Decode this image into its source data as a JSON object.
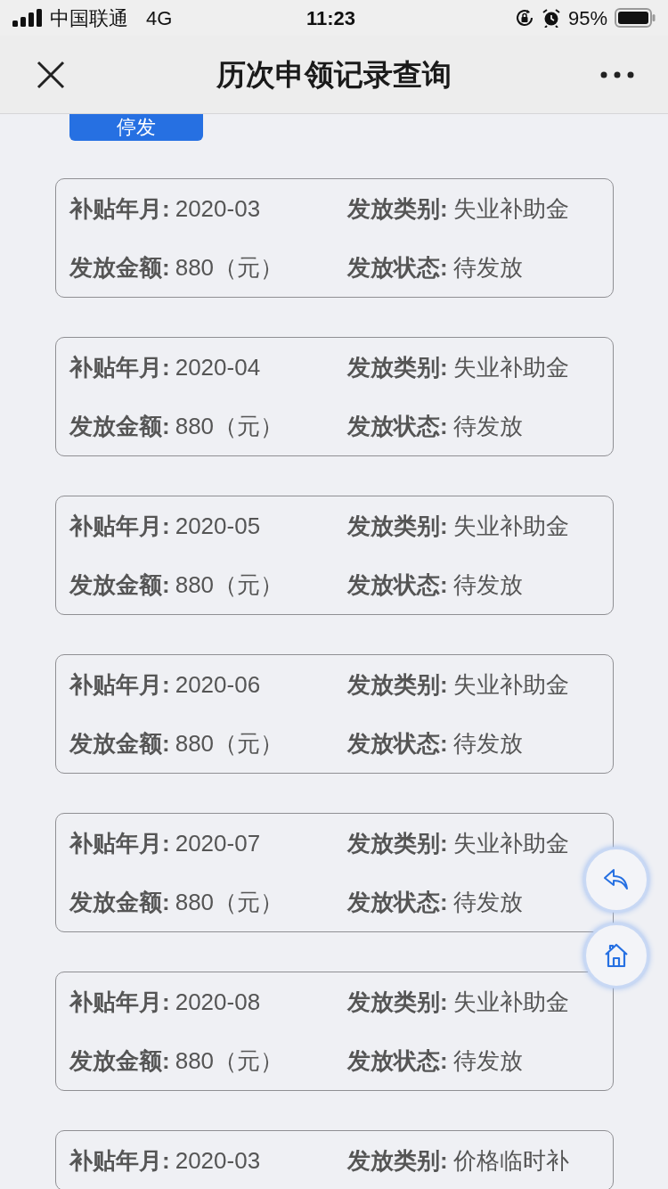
{
  "status_bar": {
    "carrier": "中国联通",
    "network": "4G",
    "time": "11:23",
    "battery": "95%"
  },
  "nav": {
    "title": "历次申领记录查询"
  },
  "top_button": {
    "label": "停发"
  },
  "records": [
    {
      "fields": [
        {
          "label": "补贴年月:",
          "value": "2020-03"
        },
        {
          "label": "发放类别:",
          "value": "失业补助金"
        },
        {
          "label": "发放金额:",
          "value": "880（元）"
        },
        {
          "label": "发放状态:",
          "value": "待发放"
        }
      ]
    },
    {
      "fields": [
        {
          "label": "补贴年月:",
          "value": "2020-04"
        },
        {
          "label": "发放类别:",
          "value": "失业补助金"
        },
        {
          "label": "发放金额:",
          "value": "880（元）"
        },
        {
          "label": "发放状态:",
          "value": "待发放"
        }
      ]
    },
    {
      "fields": [
        {
          "label": "补贴年月:",
          "value": "2020-05"
        },
        {
          "label": "发放类别:",
          "value": "失业补助金"
        },
        {
          "label": "发放金额:",
          "value": "880（元）"
        },
        {
          "label": "发放状态:",
          "value": "待发放"
        }
      ]
    },
    {
      "fields": [
        {
          "label": "补贴年月:",
          "value": "2020-06"
        },
        {
          "label": "发放类别:",
          "value": "失业补助金"
        },
        {
          "label": "发放金额:",
          "value": "880（元）"
        },
        {
          "label": "发放状态:",
          "value": "待发放"
        }
      ]
    },
    {
      "fields": [
        {
          "label": "补贴年月:",
          "value": "2020-07"
        },
        {
          "label": "发放类别:",
          "value": "失业补助金"
        },
        {
          "label": "发放金额:",
          "value": "880（元）"
        },
        {
          "label": "发放状态:",
          "value": "待发放"
        }
      ]
    },
    {
      "fields": [
        {
          "label": "补贴年月:",
          "value": "2020-08"
        },
        {
          "label": "发放类别:",
          "value": "失业补助金"
        },
        {
          "label": "发放金额:",
          "value": "880（元）"
        },
        {
          "label": "发放状态:",
          "value": "待发放"
        }
      ]
    },
    {
      "fields": [
        {
          "label": "补贴年月:",
          "value": "2020-03"
        },
        {
          "label": "发放类别:",
          "value": "价格临时补"
        }
      ]
    }
  ]
}
